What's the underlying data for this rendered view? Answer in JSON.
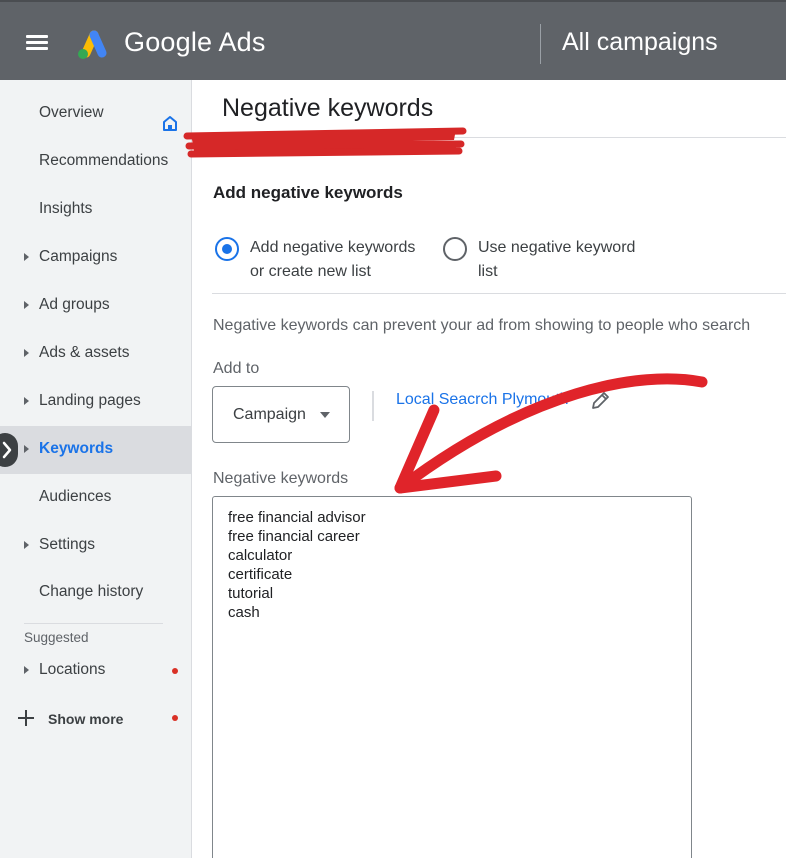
{
  "header": {
    "menu_icon": "hamburger-menu-icon",
    "logo_icon": "google-ads-logo",
    "brand": "Google Ads",
    "scope": "All campaigns"
  },
  "sidebar": {
    "items": [
      {
        "label": "Overview",
        "expandable": false,
        "icon": "home-icon"
      },
      {
        "label": "Recommendations",
        "expandable": false
      },
      {
        "label": "Insights",
        "expandable": false
      },
      {
        "label": "Campaigns",
        "expandable": true
      },
      {
        "label": "Ad groups",
        "expandable": true
      },
      {
        "label": "Ads & assets",
        "expandable": true
      },
      {
        "label": "Landing pages",
        "expandable": true
      },
      {
        "label": "Keywords",
        "expandable": true,
        "active": true
      },
      {
        "label": "Audiences",
        "expandable": false
      },
      {
        "label": "Settings",
        "expandable": true
      },
      {
        "label": "Change history",
        "expandable": false
      }
    ],
    "section_label": "Suggested",
    "suggested": [
      {
        "label": "Locations",
        "expandable": true,
        "notification": true
      }
    ],
    "show_more": "Show more"
  },
  "main": {
    "title": "Negative keywords",
    "section_title": "Add negative keywords",
    "options": [
      {
        "line1": "Add negative keywords",
        "line2": "or create new list",
        "selected": true
      },
      {
        "line1": "Use negative keyword",
        "line2": "list",
        "selected": false
      }
    ],
    "description": "Negative keywords can prevent your ad from showing to people who search",
    "add_to_label": "Add to",
    "add_to_value": "Campaign",
    "campaign_link": "Local Seacrch Plymouth",
    "keywords_label": "Negative keywords",
    "keywords": [
      "free financial advisor",
      "free financial career",
      "calculator",
      "certificate",
      "tutorial",
      "cash"
    ]
  },
  "colors": {
    "header_bg": "#5f6368",
    "sidebar_bg": "#f1f3f4",
    "accent_blue": "#1a73e8",
    "annotation_red": "#e0242a",
    "notification_red": "#d93025"
  }
}
